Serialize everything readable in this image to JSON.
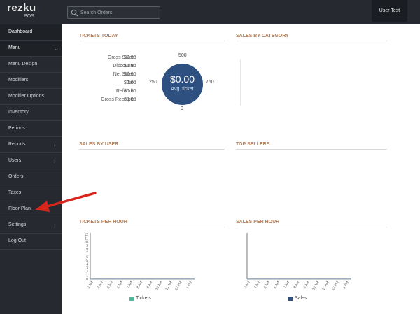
{
  "brand": {
    "name": "rezku",
    "sub": "POS"
  },
  "search": {
    "placeholder": "Search Orders"
  },
  "user": {
    "label": "User Test"
  },
  "sidebar": {
    "items": [
      {
        "label": "Dashboard",
        "chevron": ""
      },
      {
        "label": "Menu",
        "chevron": "⌄"
      },
      {
        "label": "Menu Design",
        "chevron": ""
      },
      {
        "label": "Modifiers",
        "chevron": ""
      },
      {
        "label": "Modifier Options",
        "chevron": ""
      },
      {
        "label": "Inventory",
        "chevron": ""
      },
      {
        "label": "Periods",
        "chevron": ""
      },
      {
        "label": "Reports",
        "chevron": "›"
      },
      {
        "label": "Users",
        "chevron": "›"
      },
      {
        "label": "Orders",
        "chevron": ""
      },
      {
        "label": "Taxes",
        "chevron": ""
      },
      {
        "label": "Floor Plan",
        "chevron": ""
      },
      {
        "label": "Settings",
        "chevron": "›"
      },
      {
        "label": "Log Out",
        "chevron": ""
      }
    ]
  },
  "panels": {
    "tickets_today": "TICKETS TODAY",
    "sales_by_category": "SALES BY CATEGORY",
    "sales_by_user": "SALES BY USER",
    "top_sellers": "TOP SELLERS",
    "tickets_per_hour": "TICKETS PER HOUR",
    "sales_per_hour": "SALES PER HOUR"
  },
  "stats": [
    {
      "label": "Gross Sales:",
      "value": "$0.00"
    },
    {
      "label": "Discounts:",
      "value": "$0.00"
    },
    {
      "label": "Net Sales:",
      "value": "$0.00"
    },
    {
      "label": "Tax:",
      "value": "$0.00"
    },
    {
      "label": "Refunds:",
      "value": "$0.00"
    },
    {
      "label": "Gross Receipts:",
      "value": "$0.00"
    }
  ],
  "gauge": {
    "amount": "$0.00",
    "caption": "Avg. ticket",
    "ticks": {
      "top": "500",
      "left": "250",
      "right": "750",
      "bottom": "0"
    }
  },
  "tickets_chart": {
    "y_ticks": [
      "12",
      "11",
      "10",
      "9",
      "8",
      "7",
      "6",
      "5",
      "4",
      "3",
      "2",
      "1",
      "0"
    ],
    "x_ticks": [
      "3 AM",
      "4 AM",
      "5 AM",
      "6 AM",
      "7 AM",
      "8 AM",
      "9 AM",
      "10 AM",
      "11 AM",
      "12 PM",
      "1 PM"
    ],
    "legend": "Tickets",
    "legend_color": "#4dbb9a"
  },
  "sales_chart": {
    "x_ticks": [
      "3 AM",
      "4 AM",
      "5 AM",
      "6 AM",
      "7 AM",
      "8 AM",
      "9 AM",
      "10 AM",
      "11 AM",
      "12 PM",
      "1 PM"
    ],
    "legend": "Sales",
    "legend_color": "#2d5080"
  },
  "colors": {
    "sidebar": "#262a30",
    "accent_title": "#b27d58",
    "gauge": "#2d5080",
    "arrow": "#d9261c"
  }
}
